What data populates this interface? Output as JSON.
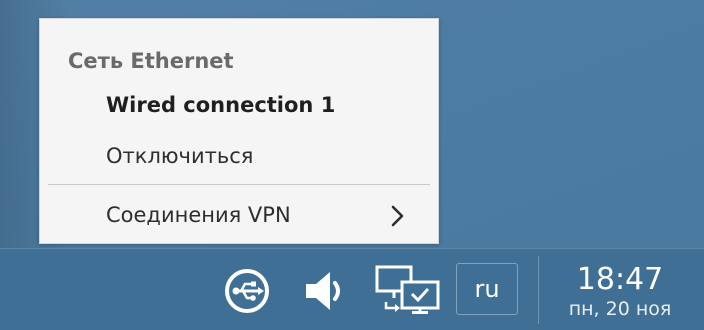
{
  "menu": {
    "header": "Сеть Ethernet",
    "active_connection": "Wired connection 1",
    "disconnect_label": "Отключиться",
    "vpn_label": "Соединения VPN"
  },
  "taskbar": {
    "icons": {
      "network": "usb-network-icon",
      "volume": "speaker-icon",
      "display": "display-switch-icon"
    },
    "language": "ru",
    "clock": {
      "time": "18:47",
      "date": "пн, 20 ноя"
    }
  },
  "colors": {
    "taskbar": "#3f6f95",
    "menu_background": "#f5f5f5",
    "icon": "#ffffff"
  }
}
